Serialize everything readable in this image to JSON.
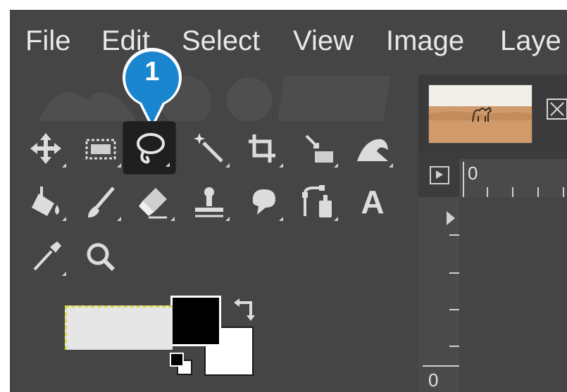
{
  "menubar": {
    "items": [
      {
        "label": "File"
      },
      {
        "label": "Edit"
      },
      {
        "label": "Select"
      },
      {
        "label": "View"
      },
      {
        "label": "Image"
      },
      {
        "label": "Laye"
      }
    ]
  },
  "callout": {
    "label": "1",
    "color": "#1a86cf"
  },
  "toolbox": {
    "tools": [
      {
        "name": "move-tool",
        "icon": "move-icon"
      },
      {
        "name": "rect-select-tool",
        "icon": "rect-select-icon"
      },
      {
        "name": "free-select-tool",
        "icon": "lasso-icon",
        "active": true
      },
      {
        "name": "fuzzy-select-tool",
        "icon": "magic-wand-icon"
      },
      {
        "name": "crop-tool",
        "icon": "crop-icon"
      },
      {
        "name": "unified-transform-tool",
        "icon": "transform-icon"
      },
      {
        "name": "warp-transform-tool",
        "icon": "warp-icon"
      },
      {
        "name": "bucket-fill-tool",
        "icon": "bucket-fill-icon"
      },
      {
        "name": "paintbrush-tool",
        "icon": "paintbrush-icon"
      },
      {
        "name": "eraser-tool",
        "icon": "eraser-icon"
      },
      {
        "name": "clone-tool",
        "icon": "clone-stamp-icon"
      },
      {
        "name": "smudge-tool",
        "icon": "smudge-icon"
      },
      {
        "name": "paths-tool",
        "icon": "paths-icon"
      },
      {
        "name": "text-tool",
        "icon": "text-icon",
        "glyph": "A"
      },
      {
        "name": "color-picker-tool",
        "icon": "eyedropper-icon"
      },
      {
        "name": "zoom-tool",
        "icon": "zoom-icon"
      }
    ]
  },
  "colors": {
    "foreground": "#000000",
    "background": "#ffffff",
    "ui_bg": "#454545",
    "accent": "#1a86cf"
  },
  "image_panel": {
    "ruler_top_label": "0",
    "ruler_left_label": "0"
  }
}
